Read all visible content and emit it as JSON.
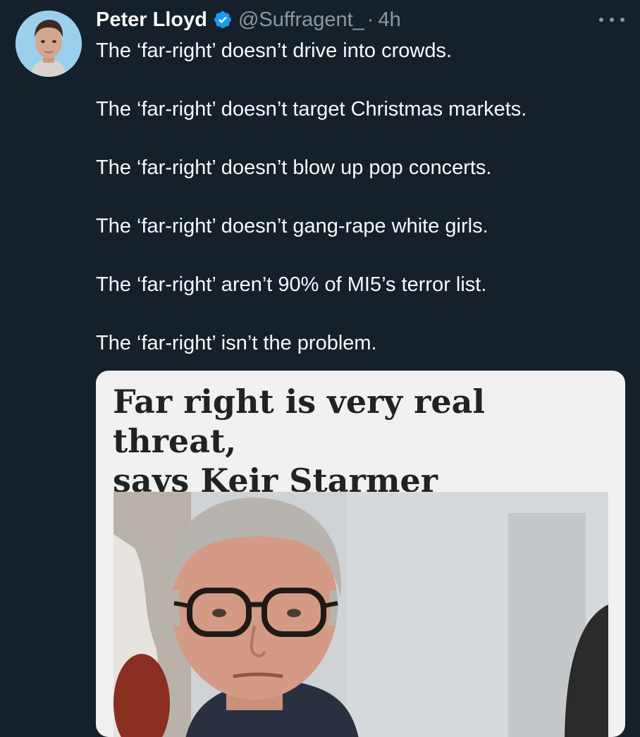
{
  "author": {
    "name": "Peter Lloyd",
    "handle": "@Suffragent_",
    "separator": "·",
    "time": "4h",
    "verified_icon": "verified-badge-icon",
    "avatar_icon": "profile-photo"
  },
  "menu": {
    "icon": "more-options-icon"
  },
  "tweet": {
    "lines": [
      "The ‘far-right’ doesn’t drive into crowds.",
      "The ‘far-right’ doesn’t target Christmas markets.",
      "The ‘far-right’ doesn’t blow up pop concerts.",
      "The ‘far-right’ doesn’t gang-rape white girls.",
      "The ‘far-right’ aren’t 90% of MI5’s terror list.",
      "The ‘far-right’ isn’t the problem."
    ]
  },
  "card": {
    "headline_line1": "Far right is very real threat,",
    "headline_line2": "says Keir Starmer",
    "image": "news-photo"
  },
  "colors": {
    "background": "#15202b",
    "text": "#f7f9f9",
    "muted": "#8b98a5",
    "verified": "#1d9bf0",
    "card_bg": "#f1f1f1",
    "headline": "#222222"
  }
}
